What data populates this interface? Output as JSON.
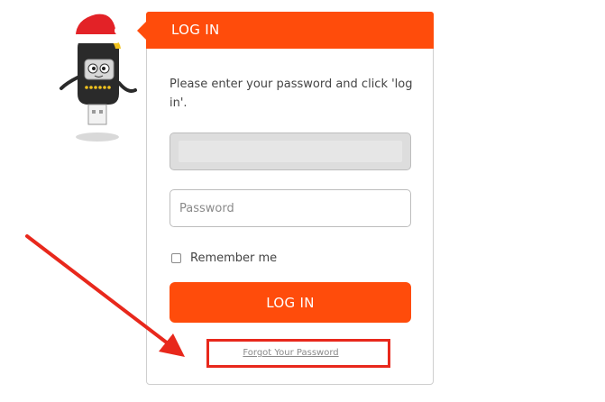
{
  "mascot": {
    "icon": "usb-mascot-santa-hat-icon"
  },
  "login": {
    "title": "LOG IN",
    "instructions": "Please enter your password and click 'log in'.",
    "username_value": "",
    "password_placeholder": "Password",
    "remember_label": "Remember me",
    "remember_checked": false,
    "button_label": "LOG IN",
    "forgot_label": "Forgot Your Password"
  },
  "annotation": {
    "color": "#e8281c",
    "arrow_icon": "red-arrow-icon",
    "highlight": "forgot-password-highlight"
  },
  "colors": {
    "accent": "#ff4c0b",
    "text": "#444444",
    "muted": "#8a8a8a"
  }
}
